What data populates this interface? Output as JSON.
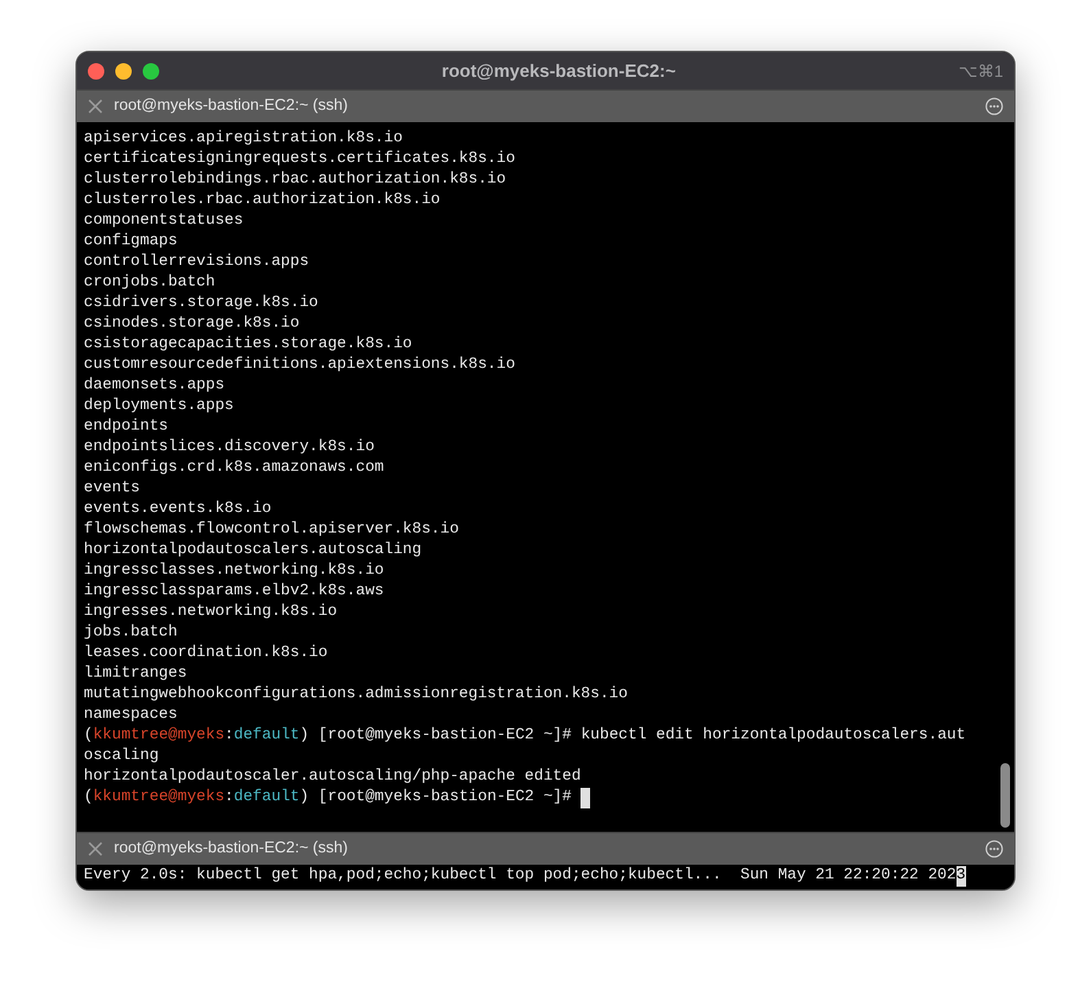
{
  "window": {
    "title": "root@myeks-bastion-EC2:~",
    "shortcut": "⌥⌘1"
  },
  "panes": [
    {
      "tab_title": "root@myeks-bastion-EC2:~ (ssh)",
      "lines": [
        {
          "segments": [
            {
              "kind": "plain",
              "text": "apiservices.apiregistration.k8s.io"
            }
          ]
        },
        {
          "segments": [
            {
              "kind": "plain",
              "text": "certificatesigningrequests.certificates.k8s.io"
            }
          ]
        },
        {
          "segments": [
            {
              "kind": "plain",
              "text": "clusterrolebindings.rbac.authorization.k8s.io"
            }
          ]
        },
        {
          "segments": [
            {
              "kind": "plain",
              "text": "clusterroles.rbac.authorization.k8s.io"
            }
          ]
        },
        {
          "segments": [
            {
              "kind": "plain",
              "text": "componentstatuses"
            }
          ]
        },
        {
          "segments": [
            {
              "kind": "plain",
              "text": "configmaps"
            }
          ]
        },
        {
          "segments": [
            {
              "kind": "plain",
              "text": "controllerrevisions.apps"
            }
          ]
        },
        {
          "segments": [
            {
              "kind": "plain",
              "text": "cronjobs.batch"
            }
          ]
        },
        {
          "segments": [
            {
              "kind": "plain",
              "text": "csidrivers.storage.k8s.io"
            }
          ]
        },
        {
          "segments": [
            {
              "kind": "plain",
              "text": "csinodes.storage.k8s.io"
            }
          ]
        },
        {
          "segments": [
            {
              "kind": "plain",
              "text": "csistoragecapacities.storage.k8s.io"
            }
          ]
        },
        {
          "segments": [
            {
              "kind": "plain",
              "text": "customresourcedefinitions.apiextensions.k8s.io"
            }
          ]
        },
        {
          "segments": [
            {
              "kind": "plain",
              "text": "daemonsets.apps"
            }
          ]
        },
        {
          "segments": [
            {
              "kind": "plain",
              "text": "deployments.apps"
            }
          ]
        },
        {
          "segments": [
            {
              "kind": "plain",
              "text": "endpoints"
            }
          ]
        },
        {
          "segments": [
            {
              "kind": "plain",
              "text": "endpointslices.discovery.k8s.io"
            }
          ]
        },
        {
          "segments": [
            {
              "kind": "plain",
              "text": "eniconfigs.crd.k8s.amazonaws.com"
            }
          ]
        },
        {
          "segments": [
            {
              "kind": "plain",
              "text": "events"
            }
          ]
        },
        {
          "segments": [
            {
              "kind": "plain",
              "text": "events.events.k8s.io"
            }
          ]
        },
        {
          "segments": [
            {
              "kind": "plain",
              "text": "flowschemas.flowcontrol.apiserver.k8s.io"
            }
          ]
        },
        {
          "segments": [
            {
              "kind": "plain",
              "text": "horizontalpodautoscalers.autoscaling"
            }
          ]
        },
        {
          "segments": [
            {
              "kind": "plain",
              "text": "ingressclasses.networking.k8s.io"
            }
          ]
        },
        {
          "segments": [
            {
              "kind": "plain",
              "text": "ingressclassparams.elbv2.k8s.aws"
            }
          ]
        },
        {
          "segments": [
            {
              "kind": "plain",
              "text": "ingresses.networking.k8s.io"
            }
          ]
        },
        {
          "segments": [
            {
              "kind": "plain",
              "text": "jobs.batch"
            }
          ]
        },
        {
          "segments": [
            {
              "kind": "plain",
              "text": "leases.coordination.k8s.io"
            }
          ]
        },
        {
          "segments": [
            {
              "kind": "plain",
              "text": "limitranges"
            }
          ]
        },
        {
          "segments": [
            {
              "kind": "plain",
              "text": "mutatingwebhookconfigurations.admissionregistration.k8s.io"
            }
          ]
        },
        {
          "segments": [
            {
              "kind": "plain",
              "text": "namespaces"
            }
          ]
        },
        {
          "segments": [
            {
              "kind": "plain",
              "text": "("
            },
            {
              "kind": "user",
              "text": "kkumtree@myeks"
            },
            {
              "kind": "plain",
              "text": ":"
            },
            {
              "kind": "context",
              "text": "default"
            },
            {
              "kind": "plain",
              "text": ") [root@myeks-bastion-EC2 ~]# kubectl edit horizontalpodautoscalers.aut"
            }
          ]
        },
        {
          "segments": [
            {
              "kind": "plain",
              "text": "oscaling"
            }
          ]
        },
        {
          "segments": [
            {
              "kind": "plain",
              "text": "horizontalpodautoscaler.autoscaling/php-apache edited"
            }
          ]
        },
        {
          "segments": [
            {
              "kind": "plain",
              "text": "("
            },
            {
              "kind": "user",
              "text": "kkumtree@myeks"
            },
            {
              "kind": "plain",
              "text": ":"
            },
            {
              "kind": "context",
              "text": "default"
            },
            {
              "kind": "plain",
              "text": ") [root@myeks-bastion-EC2 ~]# "
            },
            {
              "kind": "cursor"
            }
          ]
        }
      ]
    },
    {
      "tab_title": "root@myeks-bastion-EC2:~ (ssh)",
      "lines": [
        {
          "segments": [
            {
              "kind": "plain",
              "text": "Every 2.0s: kubectl get hpa,pod;echo;kubectl top pod;echo;kubectl...  Sun May 21 22:20:22 202"
            },
            {
              "kind": "cursor",
              "text": "3"
            }
          ]
        }
      ]
    }
  ]
}
